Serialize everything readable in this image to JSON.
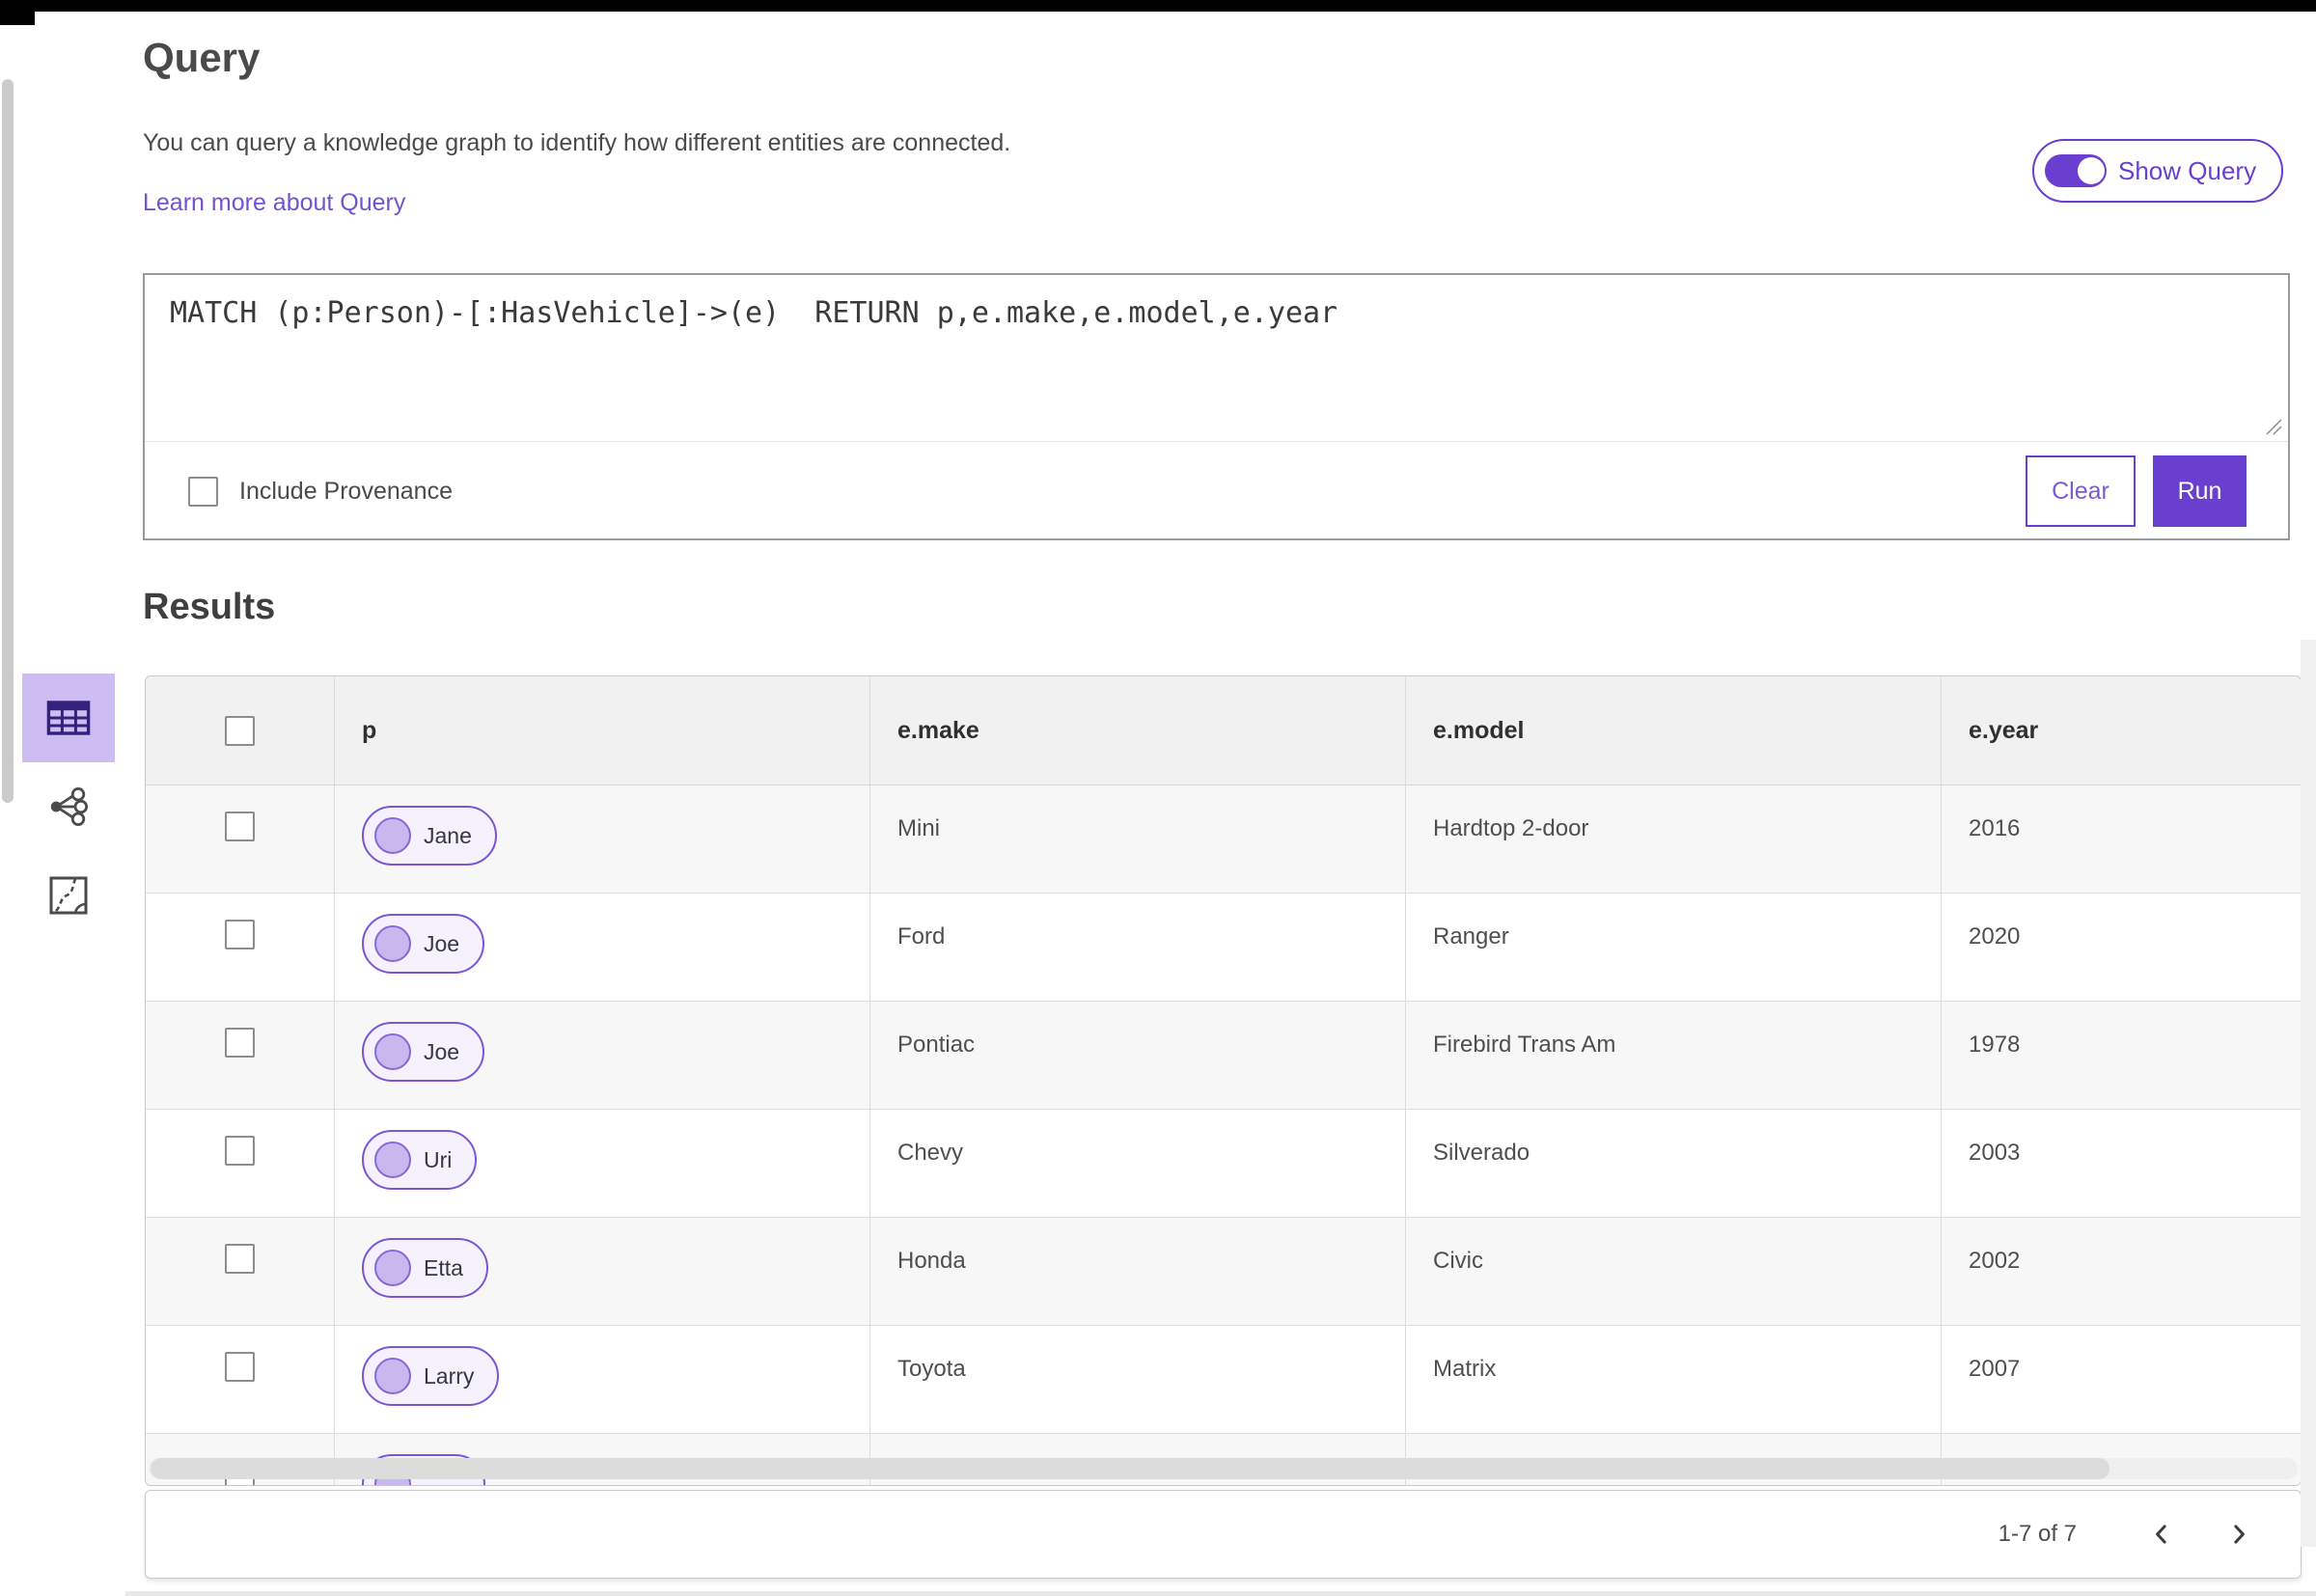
{
  "header": {
    "title": "Query",
    "description": "You can query a knowledge graph to identify how different entities are connected.",
    "learn_more_label": "Learn more about Query",
    "show_query_label": "Show Query",
    "show_query_toggle_state": "on"
  },
  "query_editor": {
    "query_text": "MATCH (p:Person)-[:HasVehicle]->(e)  RETURN p,e.make,e.model,e.year",
    "include_provenance_label": "Include Provenance",
    "include_provenance_checked": false,
    "clear_label": "Clear",
    "run_label": "Run"
  },
  "results": {
    "title": "Results",
    "view_rail": [
      {
        "id": "table-view",
        "icon": "table-icon",
        "selected": true
      },
      {
        "id": "link-chart-view",
        "icon": "link-chart-icon",
        "selected": false
      },
      {
        "id": "map-view",
        "icon": "map-icon",
        "selected": false
      }
    ],
    "table": {
      "select_all_checked": false,
      "columns": [
        "p",
        "e.make",
        "e.model",
        "e.year"
      ],
      "rows": [
        {
          "p": "Jane",
          "make": "Mini",
          "model": "Hardtop 2-door",
          "year": "2016",
          "checked": false
        },
        {
          "p": "Joe",
          "make": "Ford",
          "model": "Ranger",
          "year": "2020",
          "checked": false
        },
        {
          "p": "Joe",
          "make": "Pontiac",
          "model": "Firebird Trans Am",
          "year": "1978",
          "checked": false
        },
        {
          "p": "Uri",
          "make": "Chevy",
          "model": "Silverado",
          "year": "2003",
          "checked": false
        },
        {
          "p": "Etta",
          "make": "Honda",
          "model": "Civic",
          "year": "2002",
          "checked": false
        },
        {
          "p": "Larry",
          "make": "Toyota",
          "model": "Matrix",
          "year": "2007",
          "checked": false
        }
      ],
      "partial_seventh_row_visible": true
    },
    "pagination": {
      "range_label": "1-7 of 7",
      "prev_icon": "chevron-left",
      "next_icon": "chevron-right"
    }
  },
  "colors": {
    "primary_purple": "#6a3fd0",
    "link_purple": "#7452cc",
    "pill_border": "#7c55d4",
    "pill_background": "#f5f2fd",
    "pill_dot_fill": "#c8b8ed",
    "selected_tile_background": "#cdbdf3",
    "rail_icon_purple": "#34217e",
    "table_header_background": "#f2f1f1",
    "row_alternate_background": "#f7f7f7",
    "text_dark": "#3f3f3f"
  }
}
